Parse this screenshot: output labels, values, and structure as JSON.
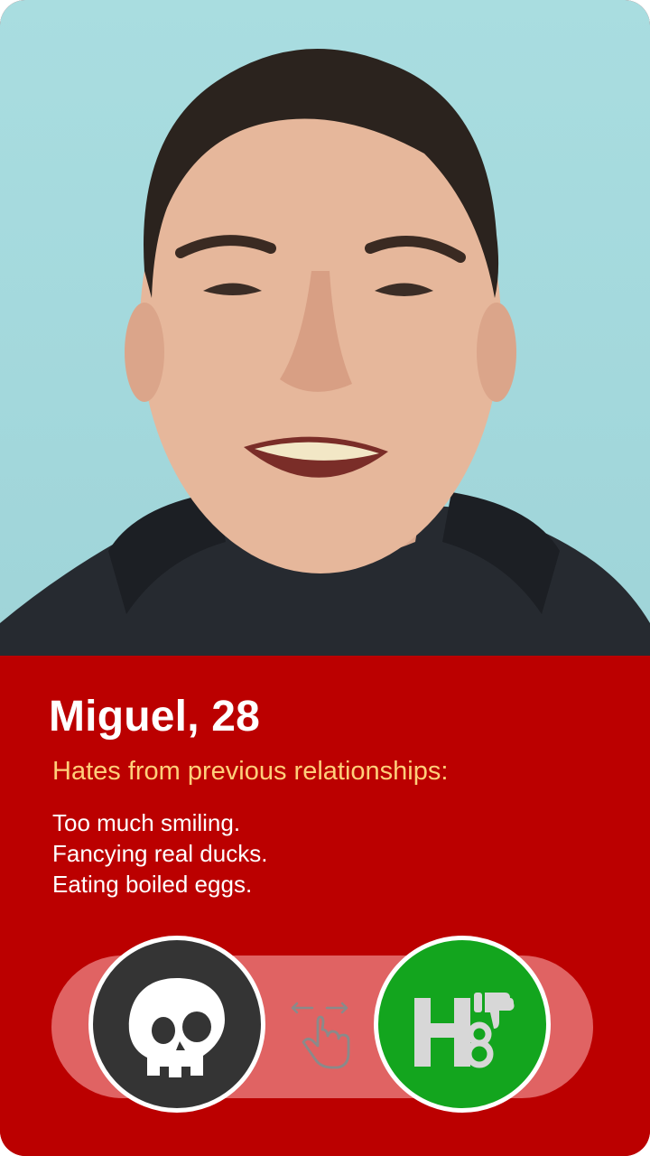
{
  "profile": {
    "name_age": "Miguel, 28",
    "photo": "profile-photo"
  },
  "hates": {
    "heading": "Hates from previous relationships:",
    "items": [
      "Too much smiling.",
      "Fancying real ducks.",
      "Eating boiled eggs."
    ]
  },
  "actions": {
    "nope_icon": "skull-icon",
    "hate_icon": "h8-thumbs-down-icon",
    "swipe_hint_icon": "swipe-hand-icon"
  },
  "colors": {
    "panel": "#bb0000",
    "heading": "#ffcf7a",
    "track": "#e06363",
    "nope_button": "#343434",
    "hate_button": "#13a51e",
    "photo_background": "#a9dde0"
  }
}
